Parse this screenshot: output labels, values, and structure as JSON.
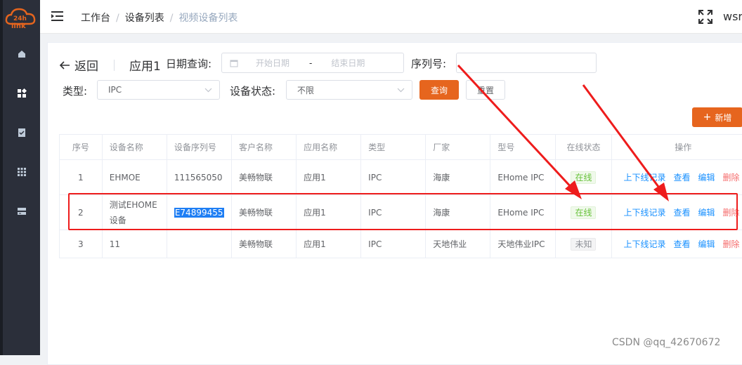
{
  "sidebar": {
    "logo_text": "24h link",
    "icons": [
      "home-icon",
      "dashboard-icon",
      "document-icon",
      "grid-icon",
      "server-icon"
    ]
  },
  "header": {
    "breadcrumb": [
      "工作台",
      "设备列表",
      "视频设备列表"
    ],
    "user": "wsr"
  },
  "toolbar": {
    "back_label": "返回",
    "app_name": "应用1",
    "date_label": "日期查询:",
    "start_placeholder": "开始日期",
    "date_separator": "-",
    "end_placeholder": "结束日期",
    "serial_label": "序列号:",
    "serial_value": "",
    "type_label": "类型:",
    "type_value": "IPC",
    "status_label": "设备状态:",
    "status_value": "不限",
    "query_label": "查询",
    "reset_label": "重置",
    "add_label": "新增"
  },
  "table": {
    "headers": [
      "序号",
      "设备名称",
      "设备序列号",
      "客户名称",
      "应用名称",
      "类型",
      "厂家",
      "型号",
      "在线状态",
      "操作"
    ],
    "rows": [
      {
        "no": "1",
        "name": "EHMOE",
        "serial": "111565050",
        "customer": "美畅物联",
        "app": "应用1",
        "type": "IPC",
        "vendor": "海康",
        "model": "EHome IPC",
        "status": "在线"
      },
      {
        "no": "2",
        "name": "测试EHOME设备",
        "serial": "E74899455",
        "customer": "美畅物联",
        "app": "应用1",
        "type": "IPC",
        "vendor": "海康",
        "model": "EHome IPC",
        "status": "在线"
      },
      {
        "no": "3",
        "name": "11",
        "serial": "",
        "customer": "美畅物联",
        "app": "应用1",
        "type": "IPC",
        "vendor": "天地伟业",
        "model": "天地伟业IPC",
        "status": "未知"
      }
    ],
    "actions": {
      "records": "上下线记录",
      "view": "查看",
      "edit": "编辑",
      "delete": "删除"
    }
  },
  "colors": {
    "accent": "#e6651e",
    "link": "#1890ff",
    "danger": "#f56c6c",
    "online": "#67c23a",
    "annotation": "#ee1c1c"
  },
  "watermark": "CSDN @qq_42670672"
}
